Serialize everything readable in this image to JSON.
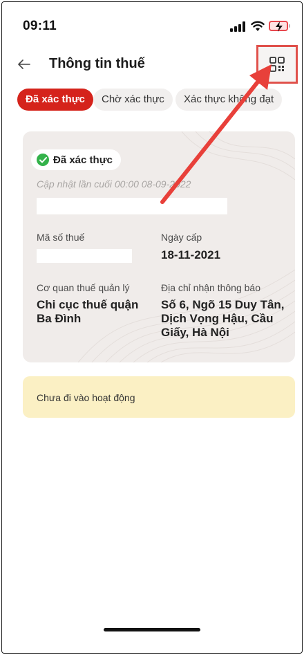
{
  "status_bar": {
    "time": "09:11",
    "battery_state": "charging-low"
  },
  "header": {
    "back_icon": "arrow-left-icon",
    "title": "Thông tin thuế",
    "qr_icon": "qr-code-icon"
  },
  "tabs": [
    {
      "label": "Đã xác thực",
      "active": true
    },
    {
      "label": "Chờ xác thực",
      "active": false
    },
    {
      "label": "Xác thực không đạt",
      "active": false
    }
  ],
  "card": {
    "badge": "Đã xác thực",
    "badge_icon": "check-circle-icon",
    "last_updated": "Cập nhật lần cuối 00:00 08-09-2022",
    "tax_code_label": "Mã số thuế",
    "issue_date_label": "Ngày cấp",
    "issue_date": "18-11-2021",
    "tax_office_label": "Cơ quan thuế quản lý",
    "tax_office": "Chi cục thuế quận Ba Đình",
    "address_label": "Địa chỉ nhận thông báo",
    "address": "Số 6, Ngõ 15 Duy Tân, Dịch Vọng Hậu, Cầu Giấy, Hà Nội"
  },
  "notice": {
    "text": "Chưa đi vào hoạt động"
  },
  "colors": {
    "accent": "#d5231b",
    "highlight": "#e0514b",
    "success": "#33b24a",
    "notice_bg": "#fbf0c4"
  }
}
